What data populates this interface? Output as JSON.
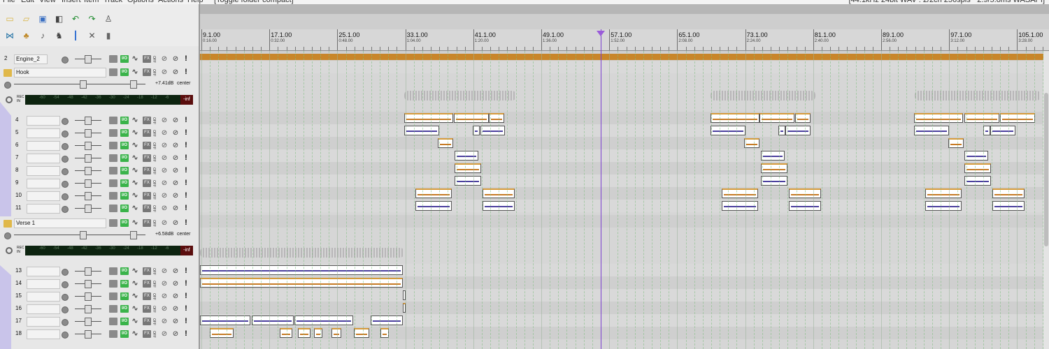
{
  "menubar": {
    "items": [
      "File",
      "Edit",
      "View",
      "Insert",
      "Item",
      "Track",
      "Options",
      "Actions",
      "Help",
      "[Toggle folder compact]"
    ],
    "right_text": "[44.1kHz 24bit WAV : 2/2ch 256spls ~2.9/5.8ms WASAPI]"
  },
  "toolbar": {
    "row1": [
      "new-project-icon",
      "open-project-icon",
      "save-project-icon",
      "project-settings-icon",
      "undo-icon",
      "redo-icon",
      "metronome-icon"
    ],
    "row2": [
      "ripple-edit-icon",
      "item-grouping-icon",
      "speaker-icon",
      "envelope-lock-icon",
      "grid-snap-icon",
      "crossfade-icon",
      "lock-icon"
    ]
  },
  "tracks": [
    {
      "num": "2",
      "name": "Engine_2",
      "type": "track"
    },
    {
      "num": "",
      "name": "Hook",
      "type": "folder",
      "volume": "+7.41dB",
      "pan": "center"
    },
    {
      "num": "4",
      "name": ""
    },
    {
      "num": "5",
      "name": ""
    },
    {
      "num": "6",
      "name": ""
    },
    {
      "num": "7",
      "name": ""
    },
    {
      "num": "8",
      "name": ""
    },
    {
      "num": "9",
      "name": ""
    },
    {
      "num": "10",
      "name": ""
    },
    {
      "num": "11",
      "name": ""
    },
    {
      "num": "",
      "name": "Verse 1",
      "type": "folder",
      "volume": "+6.58dB",
      "pan": "center"
    },
    {
      "num": "13",
      "name": ""
    },
    {
      "num": "14",
      "name": ""
    },
    {
      "num": "15",
      "name": ""
    },
    {
      "num": "16",
      "name": ""
    },
    {
      "num": "17",
      "name": ""
    },
    {
      "num": "18",
      "name": ""
    }
  ],
  "meter": {
    "rec_label": "REC IN",
    "scale": [
      "-60",
      "-54",
      "-48",
      "-42",
      "-36",
      "-30",
      "-24",
      "-18",
      "-12",
      "-6"
    ],
    "peak": "-inf"
  },
  "ruler": {
    "marks": [
      {
        "bar": "9.1.00",
        "time": "0:16.00"
      },
      {
        "bar": "17.1.00",
        "time": "0:32.00"
      },
      {
        "bar": "25.1.00",
        "time": "0:48.00"
      },
      {
        "bar": "33.1.00",
        "time": "1:04.00"
      },
      {
        "bar": "41.1.00",
        "time": "1:20.00"
      },
      {
        "bar": "49.1.00",
        "time": "1:36.00"
      },
      {
        "bar": "57.1.00",
        "time": "1:52.00"
      },
      {
        "bar": "65.1.00",
        "time": "2:08.00"
      },
      {
        "bar": "73.1.00",
        "time": "2:24.00"
      },
      {
        "bar": "81.1.00",
        "time": "2:40.00"
      },
      {
        "bar": "89.1.00",
        "time": "2:56.00"
      },
      {
        "bar": "97.1.00",
        "time": "3:12.00"
      },
      {
        "bar": "105.1.00",
        "time": "3:28.00"
      }
    ]
  },
  "colors": {
    "accent_cursor": "#7b3fd0",
    "item_orange": "#c77a24",
    "item_purple": "#4b3f9e",
    "io_green": "#3ab34a",
    "folder_lane": "#c9c4ea"
  }
}
